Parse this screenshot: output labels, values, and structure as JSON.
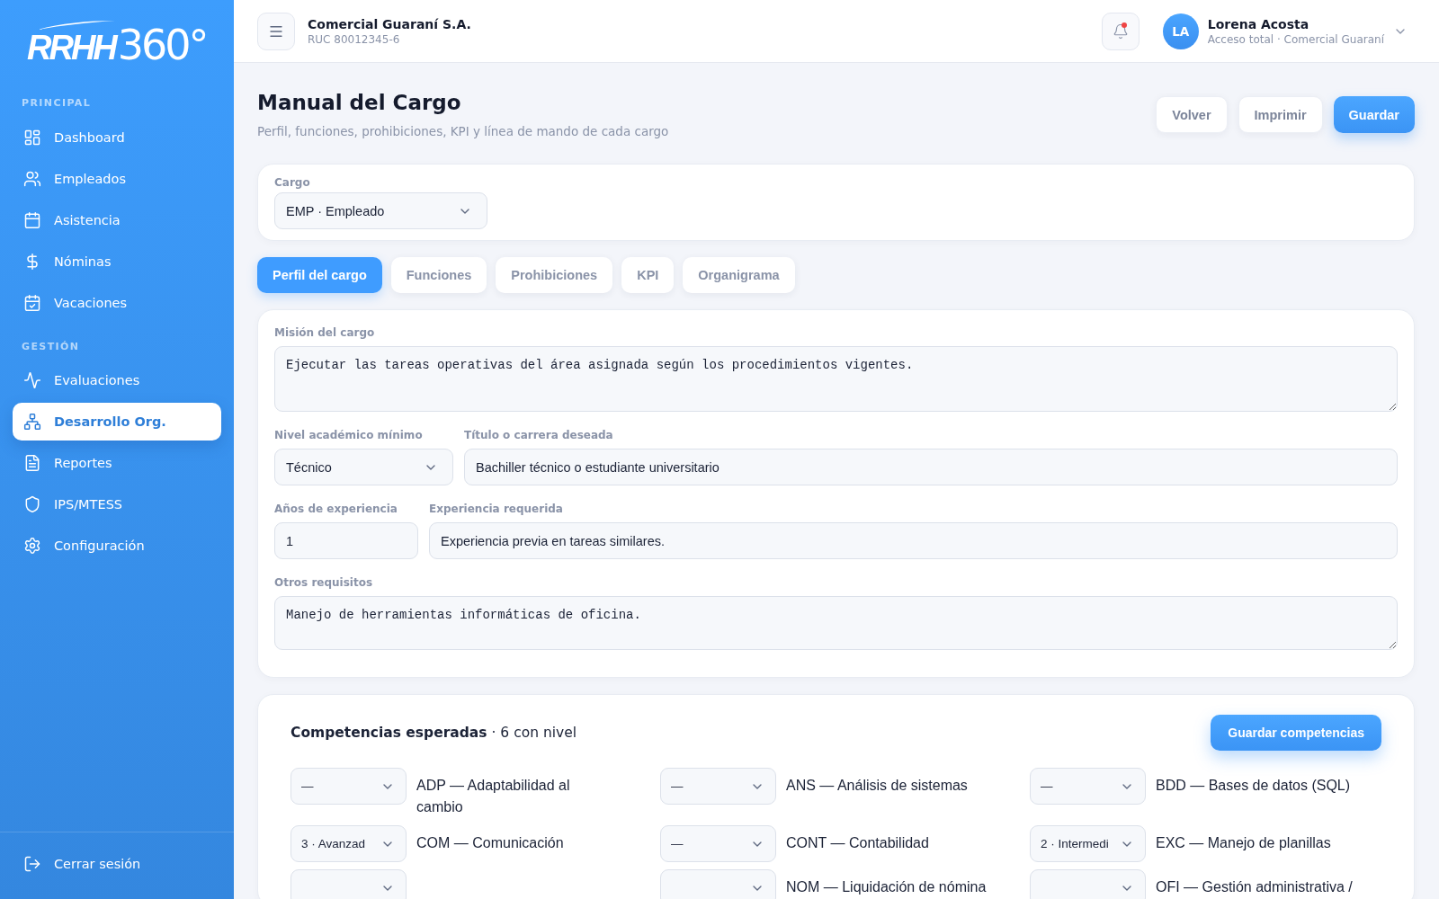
{
  "sidebar": {
    "logo": "**RRHH**360°",
    "sections": [
      {
        "title": "PRINCIPAL",
        "items": [
          {
            "label": "Dashboard",
            "selected": false
          },
          {
            "label": "Empleados",
            "selected": false
          },
          {
            "label": "Asistencia",
            "selected": false
          },
          {
            "label": "Nóminas",
            "selected": false
          },
          {
            "label": "Vacaciones",
            "selected": false
          }
        ]
      },
      {
        "title": "GESTIÓN",
        "items": [
          {
            "label": "Evaluaciones",
            "selected": false
          },
          {
            "label": "Desarrollo Org.",
            "selected": true
          },
          {
            "label": "Reportes",
            "selected": false
          },
          {
            "label": "IPS/MTESS",
            "selected": false
          },
          {
            "label": "Configuración",
            "selected": false
          }
        ]
      }
    ],
    "logout": "Cerrar sesión"
  },
  "header": {
    "company": "Comercial Guaraní S.A.",
    "company_id": "RUC 80012345-6",
    "notifications": {
      "unread": true
    },
    "user": {
      "initials": "LA",
      "name": "Lorena Acosta",
      "role": "Acceso total · Comercial Guaraní"
    }
  },
  "page": {
    "title": "Manual del Cargo",
    "subtitle": "Perfil, funciones, prohibiciones, KPI y línea de mando de cada cargo",
    "actions": [
      {
        "label": "Volver",
        "kind": "secondary"
      },
      {
        "label": "Imprimir",
        "kind": "secondary"
      },
      {
        "label": "Guardar",
        "kind": "primary"
      }
    ]
  },
  "cargo": {
    "label": "Cargo",
    "value": "EMP · Empleado"
  },
  "tabs": [
    {
      "label": "Perfil del cargo",
      "selected": true
    },
    {
      "label": "Funciones",
      "selected": false
    },
    {
      "label": "Prohibiciones",
      "selected": false
    },
    {
      "label": "KPI",
      "selected": false
    },
    {
      "label": "Organigrama",
      "selected": false
    }
  ],
  "profile": {
    "rows": [
      [
        {
          "kind": "textarea",
          "label": "Misión del cargo",
          "value": "Ejecutar las tareas operativas del área asignada según los procedimientos vigentes."
        }
      ],
      [
        {
          "kind": "select",
          "label": "Nivel académico mínimo",
          "value": "Técnico"
        },
        {
          "kind": "input",
          "label": "Título o carrera deseada",
          "value": "Bachiller técnico o estudiante universitario"
        }
      ],
      [
        {
          "kind": "input",
          "label": "Años de experiencia",
          "value": "1"
        },
        {
          "kind": "input",
          "label": "Experiencia requerida",
          "value": "Experiencia previa en tareas similares."
        }
      ],
      [
        {
          "kind": "textarea",
          "label": "Otros requisitos",
          "value": "Manejo de herramientas informáticas de oficina."
        }
      ]
    ]
  },
  "competencies": {
    "title": "**Competencias esperadas** · 6 con nivel",
    "save_button": "Guardar competencias",
    "items": [
      {
        "kind": "competency",
        "dropdown": "—",
        "name": "ADP — Adaptabilidad al cambio"
      },
      {
        "kind": "competency",
        "dropdown": "—",
        "name": "ANS — Análisis de sistemas"
      },
      {
        "kind": "competency",
        "dropdown": "—",
        "name": "BDD — Bases de datos (SQL)"
      },
      {
        "kind": "competency",
        "dropdown": "3 · Avanzad",
        "name": "COM — Comunicación"
      },
      {
        "kind": "competency",
        "dropdown": "—",
        "name": "CONT — Contabilidad"
      },
      {
        "kind": "competency",
        "dropdown": "2 · Intermedi",
        "name": "EXC — Manejo de planillas"
      },
      {
        "kind": "blank"
      },
      {
        "kind": "competency",
        "name": "NOM — Liquidación de nómina"
      },
      {
        "kind": "competency",
        "name": "OFI — Gestión administrativa /"
      }
    ]
  }
}
